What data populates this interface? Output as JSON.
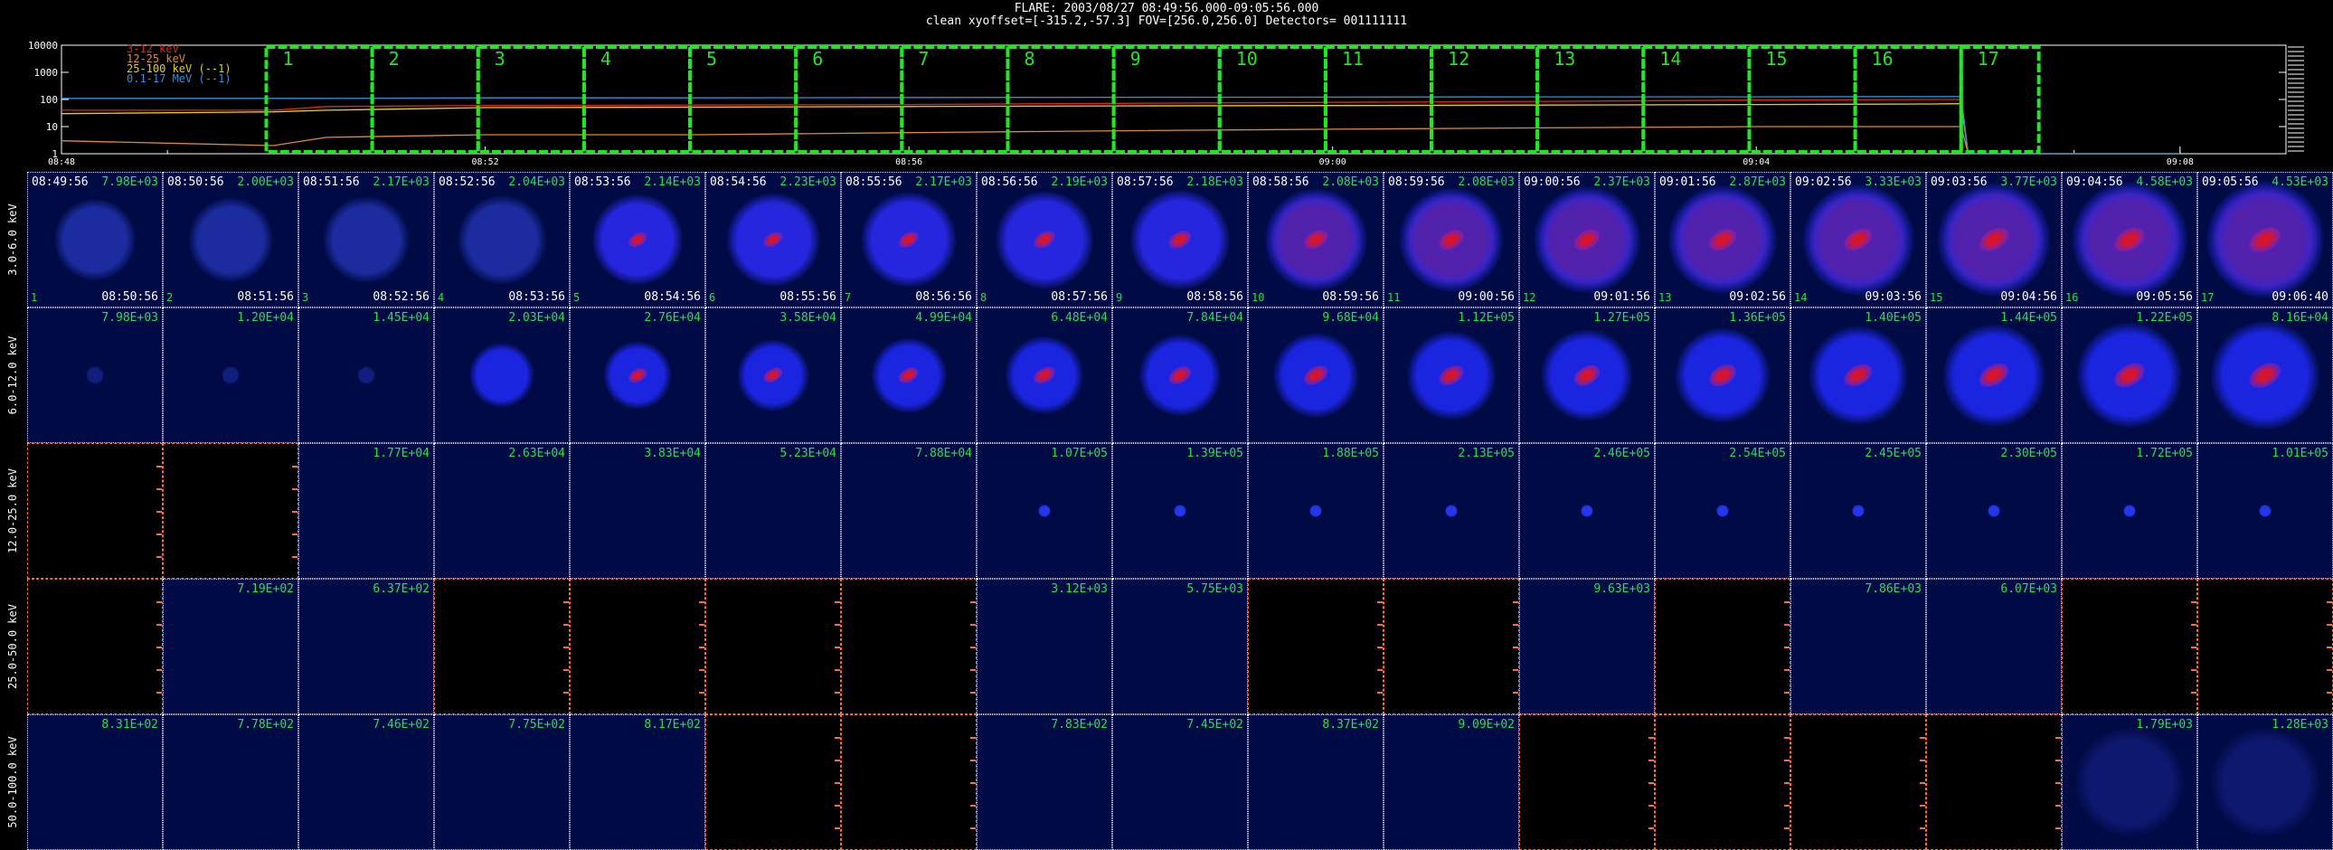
{
  "header": {
    "line1": "FLARE: 2003/08/27 08:49:56.000-09:05:56.000",
    "line2": "clean    xyoffset=[-315.2,-57.3]   FOV=[256.0,256.0]   Detectors= 001111111"
  },
  "lightcurve": {
    "legend": [
      {
        "label": "3-12 keV",
        "color": "#e0251f"
      },
      {
        "label": "12-25 keV",
        "color": "#e08a30"
      },
      {
        "label": "25-100 keV (--1)",
        "color": "#e8d200"
      },
      {
        "label": "0.1-17 MeV (--1)",
        "color": "#2e8fe0"
      }
    ],
    "y_ticks": [
      "10000",
      "1000",
      "100",
      "10",
      "1"
    ],
    "x_ticks": [
      "08:48",
      "08:52",
      "08:56",
      "09:00",
      "09:04",
      "09:08"
    ],
    "interval_numbers": [
      "1",
      "2",
      "3",
      "4",
      "5",
      "6",
      "7",
      "8",
      "9",
      "10",
      "11",
      "12",
      "13",
      "14",
      "15",
      "16",
      "17"
    ]
  },
  "chart_data": {
    "type": "line",
    "x": [
      "08:48",
      "08:50",
      "08:50:30",
      "08:52",
      "08:54",
      "08:56",
      "08:58",
      "09:00",
      "09:02",
      "09:04",
      "09:05:40",
      "09:05:56",
      "09:06",
      "09:08"
    ],
    "series": [
      {
        "name": "3-12 keV",
        "values": [
          40,
          40,
          55,
          60,
          62,
          65,
          72,
          78,
          85,
          95,
          100,
          100,
          1,
          1
        ]
      },
      {
        "name": "12-25 keV",
        "values": [
          3,
          2,
          4,
          5,
          5,
          6,
          7,
          8,
          9,
          10,
          10,
          10,
          1,
          1
        ]
      },
      {
        "name": "25-100 keV (--1)",
        "values": [
          30,
          35,
          40,
          50,
          52,
          55,
          58,
          60,
          62,
          65,
          68,
          70,
          1,
          1
        ]
      },
      {
        "name": "0.1-17 MeV (--1)",
        "values": [
          110,
          110,
          110,
          115,
          115,
          118,
          120,
          122,
          125,
          125,
          128,
          128,
          1,
          1
        ]
      }
    ],
    "ylim": [
      1,
      10000
    ],
    "yscale": "log"
  },
  "rows": [
    {
      "label": "3.0-6.0 keV",
      "cells": [
        {
          "start": "08:49:56",
          "end": "08:50:56",
          "num": "1",
          "max": "7.98E+03",
          "empty": false
        },
        {
          "start": "08:50:56",
          "end": "08:51:56",
          "num": "2",
          "max": "2.00E+03",
          "empty": false
        },
        {
          "start": "08:51:56",
          "end": "08:52:56",
          "num": "3",
          "max": "2.17E+03",
          "empty": false
        },
        {
          "start": "08:52:56",
          "end": "08:53:56",
          "num": "4",
          "max": "2.04E+03",
          "empty": false
        },
        {
          "start": "08:53:56",
          "end": "08:54:56",
          "num": "5",
          "max": "2.14E+03",
          "empty": false
        },
        {
          "start": "08:54:56",
          "end": "08:55:56",
          "num": "6",
          "max": "2.23E+03",
          "empty": false
        },
        {
          "start": "08:55:56",
          "end": "08:56:56",
          "num": "7",
          "max": "2.17E+03",
          "empty": false
        },
        {
          "start": "08:56:56",
          "end": "08:57:56",
          "num": "8",
          "max": "2.19E+03",
          "empty": false
        },
        {
          "start": "08:57:56",
          "end": "08:58:56",
          "num": "9",
          "max": "2.18E+03",
          "empty": false
        },
        {
          "start": "08:58:56",
          "end": "08:59:56",
          "num": "10",
          "max": "2.08E+03",
          "empty": false
        },
        {
          "start": "08:59:56",
          "end": "09:00:56",
          "num": "11",
          "max": "2.08E+03",
          "empty": false
        },
        {
          "start": "09:00:56",
          "end": "09:01:56",
          "num": "12",
          "max": "2.37E+03",
          "empty": false
        },
        {
          "start": "09:01:56",
          "end": "09:02:56",
          "num": "13",
          "max": "2.87E+03",
          "empty": false
        },
        {
          "start": "09:02:56",
          "end": "09:03:56",
          "num": "14",
          "max": "3.33E+03",
          "empty": false
        },
        {
          "start": "09:03:56",
          "end": "09:04:56",
          "num": "15",
          "max": "3.77E+03",
          "empty": false
        },
        {
          "start": "09:04:56",
          "end": "09:05:56",
          "num": "16",
          "max": "4.58E+03",
          "empty": false
        },
        {
          "start": "09:05:56",
          "end": "09:06:40",
          "num": "17",
          "max": "4.53E+03",
          "empty": false
        }
      ]
    },
    {
      "label": "6.0-12.0 keV",
      "cells": [
        {
          "max": "7.98E+03",
          "empty": false
        },
        {
          "max": "1.20E+04",
          "empty": false
        },
        {
          "max": "1.45E+04",
          "empty": false
        },
        {
          "max": "2.03E+04",
          "empty": false
        },
        {
          "max": "2.76E+04",
          "empty": false
        },
        {
          "max": "3.58E+04",
          "empty": false
        },
        {
          "max": "4.99E+04",
          "empty": false
        },
        {
          "max": "6.48E+04",
          "empty": false
        },
        {
          "max": "7.84E+04",
          "empty": false
        },
        {
          "max": "9.68E+04",
          "empty": false
        },
        {
          "max": "1.12E+05",
          "empty": false
        },
        {
          "max": "1.27E+05",
          "empty": false
        },
        {
          "max": "1.36E+05",
          "empty": false
        },
        {
          "max": "1.40E+05",
          "empty": false
        },
        {
          "max": "1.44E+05",
          "empty": false
        },
        {
          "max": "1.22E+05",
          "empty": false
        },
        {
          "max": "8.16E+04",
          "empty": false
        }
      ]
    },
    {
      "label": "12.0-25.0 keV",
      "cells": [
        {
          "max": "",
          "empty": true
        },
        {
          "max": "",
          "empty": true
        },
        {
          "max": "1.77E+04",
          "empty": false
        },
        {
          "max": "2.63E+04",
          "empty": false
        },
        {
          "max": "3.83E+04",
          "empty": false
        },
        {
          "max": "5.23E+04",
          "empty": false
        },
        {
          "max": "7.88E+04",
          "empty": false
        },
        {
          "max": "1.07E+05",
          "empty": false
        },
        {
          "max": "1.39E+05",
          "empty": false
        },
        {
          "max": "1.88E+05",
          "empty": false
        },
        {
          "max": "2.13E+05",
          "empty": false
        },
        {
          "max": "2.46E+05",
          "empty": false
        },
        {
          "max": "2.54E+05",
          "empty": false
        },
        {
          "max": "2.45E+05",
          "empty": false
        },
        {
          "max": "2.30E+05",
          "empty": false
        },
        {
          "max": "1.72E+05",
          "empty": false
        },
        {
          "max": "1.01E+05",
          "empty": false
        }
      ]
    },
    {
      "label": "25.0-50.0 keV",
      "cells": [
        {
          "max": "",
          "empty": true
        },
        {
          "max": "7.19E+02",
          "empty": false
        },
        {
          "max": "6.37E+02",
          "empty": false
        },
        {
          "max": "",
          "empty": true
        },
        {
          "max": "",
          "empty": true
        },
        {
          "max": "",
          "empty": true
        },
        {
          "max": "",
          "empty": true
        },
        {
          "max": "3.12E+03",
          "empty": false
        },
        {
          "max": "5.75E+03",
          "empty": false
        },
        {
          "max": "",
          "empty": true
        },
        {
          "max": "",
          "empty": true
        },
        {
          "max": "9.63E+03",
          "empty": false
        },
        {
          "max": "",
          "empty": true
        },
        {
          "max": "7.86E+03",
          "empty": false
        },
        {
          "max": "6.07E+03",
          "empty": false
        },
        {
          "max": "",
          "empty": true
        },
        {
          "max": "",
          "empty": true
        }
      ]
    },
    {
      "label": "50.0-100.0 keV",
      "cells": [
        {
          "max": "8.31E+02",
          "empty": false
        },
        {
          "max": "7.78E+02",
          "empty": false
        },
        {
          "max": "7.46E+02",
          "empty": false
        },
        {
          "max": "7.75E+02",
          "empty": false
        },
        {
          "max": "8.17E+02",
          "empty": false
        },
        {
          "max": "",
          "empty": true
        },
        {
          "max": "",
          "empty": true
        },
        {
          "max": "7.83E+02",
          "empty": false
        },
        {
          "max": "7.45E+02",
          "empty": false
        },
        {
          "max": "8.37E+02",
          "empty": false
        },
        {
          "max": "9.09E+02",
          "empty": false
        },
        {
          "max": "",
          "empty": true
        },
        {
          "max": "",
          "empty": true
        },
        {
          "max": "",
          "empty": true
        },
        {
          "max": "",
          "empty": true
        },
        {
          "max": "1.79E+03",
          "empty": false
        },
        {
          "max": "1.28E+03",
          "empty": false
        }
      ]
    }
  ],
  "colors": {
    "image_bg": "#000b46",
    "interval_box": "#22e622",
    "max_label": "#24e24b",
    "empty_border": "#ff6b3a"
  }
}
